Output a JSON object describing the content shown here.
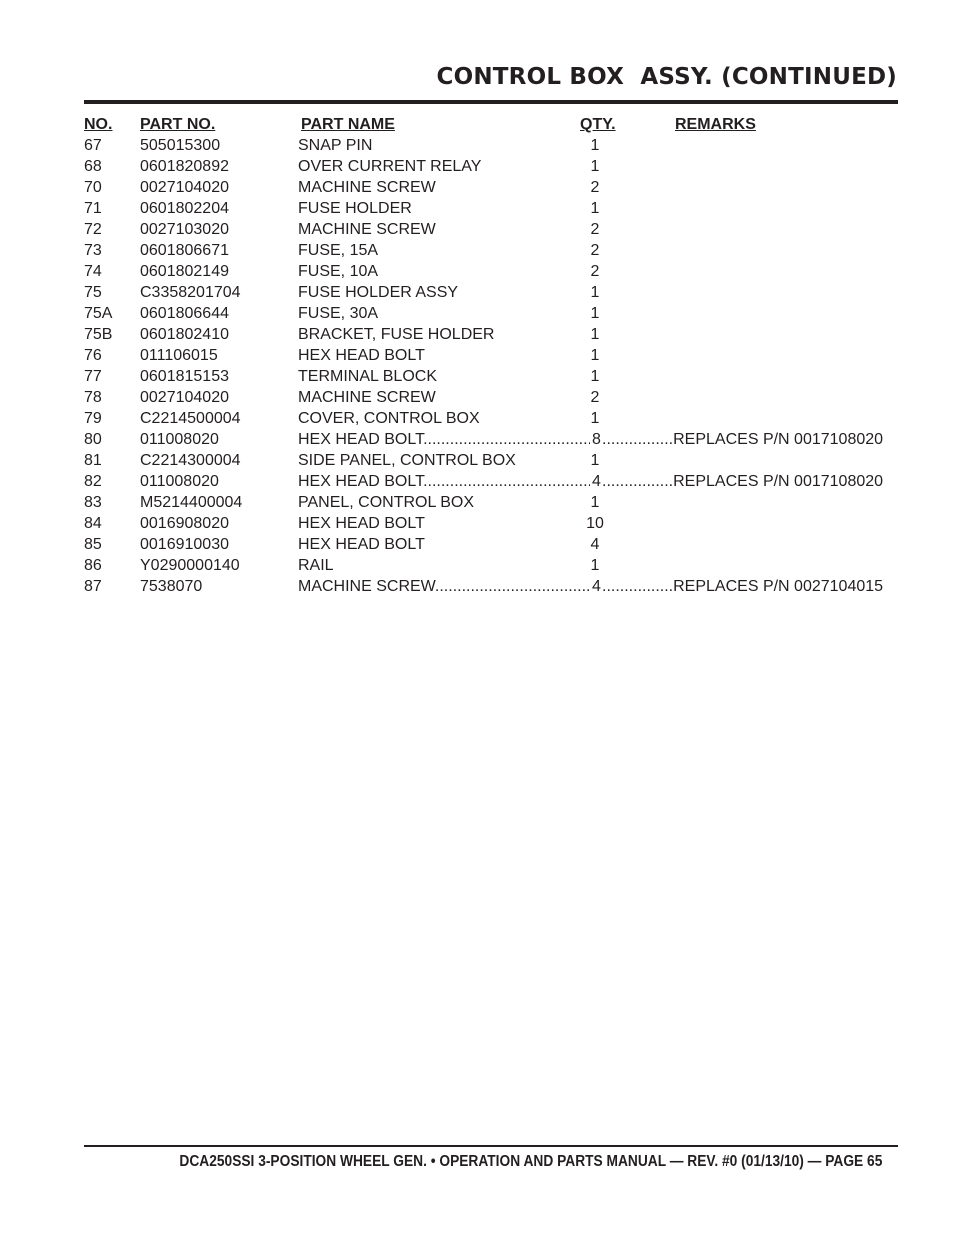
{
  "page": {
    "title": "CONTROL BOX  ASSY. (CONTINUED)",
    "footer": "DCA250SSI 3-POSITION WHEEL GEN. • OPERATION AND PARTS MANUAL — REV. #0 (01/13/10) — PAGE 65"
  },
  "table": {
    "headers": {
      "no": "NO.",
      "part_no": "PART NO.",
      "part_name": "PART NAME",
      "qty": "QTY.",
      "remarks": "REMARKS"
    },
    "rows": [
      {
        "no": "67",
        "part_no": "505015300",
        "part_name": "SNAP PIN",
        "qty": "1",
        "remarks": ""
      },
      {
        "no": "68",
        "part_no": "0601820892",
        "part_name": "OVER CURRENT RELAY",
        "qty": "1",
        "remarks": ""
      },
      {
        "no": "70",
        "part_no": "0027104020",
        "part_name": "MACHINE SCREW",
        "qty": "2",
        "remarks": ""
      },
      {
        "no": "71",
        "part_no": "0601802204",
        "part_name": "FUSE HOLDER",
        "qty": "1",
        "remarks": ""
      },
      {
        "no": "72",
        "part_no": "0027103020",
        "part_name": "MACHINE SCREW",
        "qty": "2",
        "remarks": ""
      },
      {
        "no": "73",
        "part_no": "0601806671",
        "part_name": "FUSE, 15A",
        "qty": "2",
        "remarks": ""
      },
      {
        "no": "74",
        "part_no": "0601802149",
        "part_name": "FUSE, 10A",
        "qty": "2",
        "remarks": ""
      },
      {
        "no": "75",
        "part_no": "C3358201704",
        "part_name": "FUSE HOLDER ASSY",
        "qty": "1",
        "remarks": ""
      },
      {
        "no": "75A",
        "part_no": "0601806644",
        "part_name": "FUSE, 30A",
        "qty": "1",
        "remarks": ""
      },
      {
        "no": "75B",
        "part_no": "0601802410",
        "part_name": "BRACKET, FUSE HOLDER",
        "qty": "1",
        "remarks": ""
      },
      {
        "no": "76",
        "part_no": "011106015",
        "part_name": "HEX HEAD BOLT",
        "qty": "1",
        "remarks": ""
      },
      {
        "no": "77",
        "part_no": "0601815153",
        "part_name": "TERMINAL BLOCK",
        "qty": "1",
        "remarks": ""
      },
      {
        "no": "78",
        "part_no": "0027104020",
        "part_name": "MACHINE SCREW",
        "qty": "2",
        "remarks": ""
      },
      {
        "no": "79",
        "part_no": "C2214500004",
        "part_name": "COVER, CONTROL BOX",
        "qty": "1",
        "remarks": ""
      },
      {
        "no": "80",
        "part_no": "011008020",
        "part_name": "HEX HEAD BOLT",
        "qty": "8",
        "remarks": "REPLACES P/N 0017108020"
      },
      {
        "no": "81",
        "part_no": "C2214300004",
        "part_name": "SIDE PANEL, CONTROL BOX",
        "qty": "1",
        "remarks": ""
      },
      {
        "no": "82",
        "part_no": "011008020",
        "part_name": "HEX HEAD BOLT",
        "qty": "4",
        "remarks": "REPLACES P/N 0017108020"
      },
      {
        "no": "83",
        "part_no": "M5214400004",
        "part_name": "PANEL, CONTROL BOX",
        "qty": "1",
        "remarks": ""
      },
      {
        "no": "84",
        "part_no": "0016908020",
        "part_name": "HEX HEAD BOLT",
        "qty": "10",
        "remarks": ""
      },
      {
        "no": "85",
        "part_no": "0016910030",
        "part_name": "HEX HEAD BOLT",
        "qty": "4",
        "remarks": ""
      },
      {
        "no": "86",
        "part_no": "Y0290000140",
        "part_name": "RAIL",
        "qty": "1",
        "remarks": ""
      },
      {
        "no": "87",
        "part_no": "7538070",
        "part_name": "MACHINE SCREW",
        "qty": "4",
        "remarks": "REPLACES P/N 0027104015"
      }
    ]
  }
}
